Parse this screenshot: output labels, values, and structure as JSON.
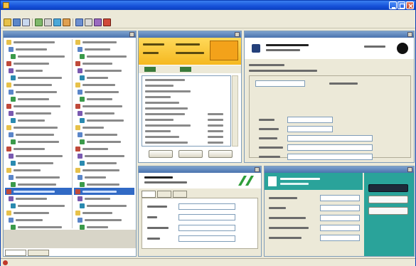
{
  "window": {
    "title": ""
  },
  "menu": {
    "items": [
      "",
      "",
      "",
      "",
      "",
      ""
    ]
  },
  "toolbar": {
    "buttons": [
      "",
      "",
      "",
      "",
      "",
      "",
      "",
      "",
      "",
      "",
      "",
      "",
      ""
    ]
  },
  "explorer": {
    "title": "",
    "left_items": [
      "",
      "",
      "",
      "",
      "",
      "",
      "",
      "",
      "",
      "",
      "",
      "",
      "",
      "",
      "",
      "",
      "",
      "",
      "",
      "",
      "",
      "",
      "",
      "",
      "",
      "",
      ""
    ],
    "right_items": [
      "",
      "",
      "",
      "",
      "",
      "",
      "",
      "",
      "",
      "",
      "",
      "",
      "",
      "",
      "",
      "",
      "",
      "",
      "",
      "",
      "",
      "",
      "",
      "",
      "",
      "",
      ""
    ],
    "selected_index": 21,
    "footer_tabs": [
      "",
      ""
    ]
  },
  "pane_yellow": {
    "title": "",
    "banner_lines": [
      "",
      "",
      "",
      ""
    ],
    "list_items": [
      "",
      "",
      "",
      "",
      "",
      "",
      "",
      "",
      "",
      "",
      "",
      ""
    ],
    "buttons": [
      "",
      "",
      ""
    ]
  },
  "pane_form": {
    "title": "",
    "heading": "",
    "section_label": "",
    "field_labels": [
      "",
      "",
      "",
      "",
      "",
      "",
      "",
      ""
    ],
    "field_values": [
      "",
      "",
      "",
      "",
      "",
      "",
      "",
      ""
    ]
  },
  "pane_green": {
    "title": "",
    "tabs": [
      "",
      "",
      ""
    ],
    "field_labels": [
      "",
      "",
      "",
      ""
    ],
    "field_values": [
      "",
      "",
      "",
      ""
    ]
  },
  "pane_teal": {
    "title": "",
    "heading": "",
    "field_labels": [
      "",
      "",
      "",
      "",
      ""
    ],
    "field_values": [
      "",
      "",
      "",
      "",
      ""
    ],
    "side_buttons": [
      "",
      "",
      ""
    ]
  },
  "statusbar": {
    "left": "",
    "middle": ""
  },
  "colors": {
    "titlebar": "#1550d8",
    "banner": "#f5b820",
    "selection": "#316ac5",
    "green_logo": "#2f9e3a",
    "teal": "#2aa39a",
    "dark_button": "#1e2a3a"
  }
}
